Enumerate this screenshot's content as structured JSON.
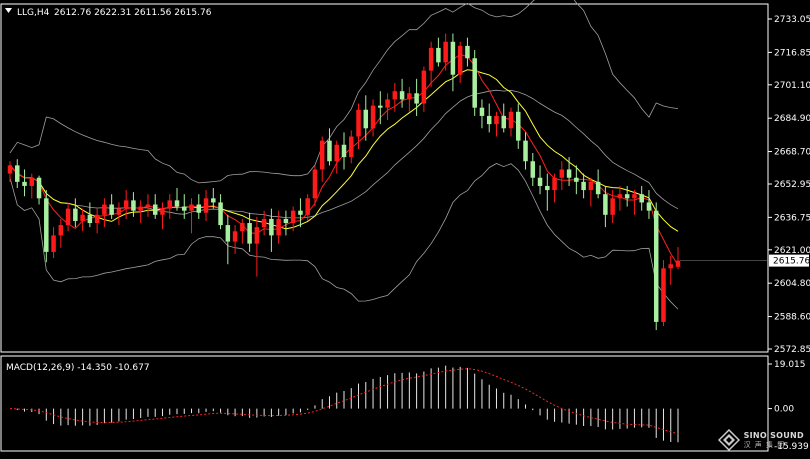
{
  "main_chart": {
    "symbol": "LLG,H4",
    "ohlc_readout": "2612.76 2622.31 2611.56 2615.76",
    "price_ticks": [
      "2733.05",
      "2716.85",
      "2701.10",
      "2684.90",
      "2668.70",
      "2652.95",
      "2636.75",
      "2621.00",
      "2604.80",
      "2588.60",
      "2572.85"
    ],
    "current_price": "2615.76"
  },
  "macd": {
    "label": "MACD(12,26,9) -14.350 -10.677",
    "ticks": [
      "19.015",
      "0.00",
      "-15.939"
    ]
  },
  "watermark": {
    "brand": "SINO SOUND",
    "cn": "汉 声 集 团"
  },
  "colors": {
    "bull": "#ff1a1a",
    "bear": "#a8f0a0",
    "grid": "#ffffff",
    "ma_fast": "#ff2020",
    "ma_slow": "#ffff30",
    "bands": "#a0a0a0",
    "signal": "#ff2020"
  },
  "chart_data": [
    {
      "type": "candlestick",
      "title": "LLG,H4",
      "ylim": [
        2572.85,
        2736
      ],
      "y_ticks": [
        2733.05,
        2716.85,
        2701.1,
        2684.9,
        2668.7,
        2652.95,
        2636.75,
        2621.0,
        2604.8,
        2588.6,
        2572.85
      ],
      "last_price": 2615.76,
      "candles": [
        [
          2658,
          2664,
          2654,
          2662
        ],
        [
          2662,
          2665,
          2651,
          2654
        ],
        [
          2654,
          2660,
          2647,
          2652
        ],
        [
          2652,
          2658,
          2646,
          2656
        ],
        [
          2656,
          2657,
          2643,
          2646
        ],
        [
          2646,
          2650,
          2615,
          2620
        ],
        [
          2620,
          2632,
          2617,
          2628
        ],
        [
          2628,
          2636,
          2622,
          2633
        ],
        [
          2633,
          2644,
          2630,
          2641
        ],
        [
          2641,
          2646,
          2632,
          2635
        ],
        [
          2635,
          2641,
          2630,
          2638
        ],
        [
          2638,
          2644,
          2632,
          2634
        ],
        [
          2634,
          2641,
          2629,
          2638
        ],
        [
          2638,
          2646,
          2632,
          2643
        ],
        [
          2643,
          2648,
          2636,
          2638
        ],
        [
          2638,
          2644,
          2633,
          2641
        ],
        [
          2641,
          2650,
          2636,
          2645
        ],
        [
          2645,
          2649,
          2637,
          2640
        ],
        [
          2640,
          2645,
          2634,
          2642
        ],
        [
          2642,
          2648,
          2637,
          2643
        ],
        [
          2643,
          2648,
          2636,
          2638
        ],
        [
          2638,
          2644,
          2631,
          2641
        ],
        [
          2641,
          2648,
          2636,
          2645
        ],
        [
          2645,
          2651,
          2640,
          2642
        ],
        [
          2642,
          2648,
          2636,
          2640
        ],
        [
          2640,
          2646,
          2629,
          2643
        ],
        [
          2643,
          2648,
          2636,
          2639
        ],
        [
          2639,
          2650,
          2635,
          2646
        ],
        [
          2646,
          2651,
          2641,
          2644
        ],
        [
          2644,
          2648,
          2631,
          2633
        ],
        [
          2633,
          2638,
          2614,
          2625
        ],
        [
          2625,
          2633,
          2619,
          2630
        ],
        [
          2630,
          2636,
          2624,
          2634
        ],
        [
          2634,
          2639,
          2620,
          2624
        ],
        [
          2624,
          2637,
          2608,
          2632
        ],
        [
          2632,
          2640,
          2628,
          2636
        ],
        [
          2636,
          2641,
          2620,
          2628
        ],
        [
          2628,
          2640,
          2624,
          2636
        ],
        [
          2636,
          2640,
          2628,
          2634
        ],
        [
          2634,
          2642,
          2630,
          2640
        ],
        [
          2640,
          2646,
          2632,
          2638
        ],
        [
          2638,
          2648,
          2635,
          2646
        ],
        [
          2646,
          2662,
          2642,
          2660
        ],
        [
          2660,
          2676,
          2654,
          2674
        ],
        [
          2674,
          2680,
          2662,
          2664
        ],
        [
          2664,
          2674,
          2658,
          2672
        ],
        [
          2672,
          2678,
          2660,
          2666
        ],
        [
          2666,
          2679,
          2663,
          2676
        ],
        [
          2676,
          2692,
          2670,
          2689
        ],
        [
          2689,
          2696,
          2674,
          2680
        ],
        [
          2680,
          2694,
          2676,
          2691
        ],
        [
          2691,
          2698,
          2682,
          2690
        ],
        [
          2690,
          2697,
          2684,
          2694
        ],
        [
          2694,
          2702,
          2688,
          2698
        ],
        [
          2698,
          2704,
          2690,
          2694
        ],
        [
          2694,
          2700,
          2688,
          2697
        ],
        [
          2697,
          2704,
          2686,
          2692
        ],
        [
          2692,
          2710,
          2688,
          2708
        ],
        [
          2708,
          2722,
          2700,
          2719
        ],
        [
          2719,
          2724,
          2710,
          2712
        ],
        [
          2712,
          2726,
          2708,
          2722
        ],
        [
          2722,
          2726,
          2698,
          2706
        ],
        [
          2706,
          2722,
          2702,
          2720
        ],
        [
          2720,
          2724,
          2710,
          2714
        ],
        [
          2714,
          2718,
          2686,
          2690
        ],
        [
          2690,
          2694,
          2680,
          2686
        ],
        [
          2686,
          2692,
          2678,
          2682
        ],
        [
          2682,
          2688,
          2676,
          2686
        ],
        [
          2686,
          2692,
          2678,
          2680
        ],
        [
          2680,
          2690,
          2676,
          2688
        ],
        [
          2688,
          2692,
          2670,
          2674
        ],
        [
          2674,
          2678,
          2660,
          2664
        ],
        [
          2664,
          2668,
          2652,
          2656
        ],
        [
          2656,
          2662,
          2648,
          2652
        ],
        [
          2652,
          2658,
          2640,
          2650
        ],
        [
          2650,
          2658,
          2644,
          2656
        ],
        [
          2656,
          2664,
          2650,
          2660
        ],
        [
          2660,
          2666,
          2652,
          2656
        ],
        [
          2656,
          2662,
          2648,
          2654
        ],
        [
          2654,
          2658,
          2646,
          2650
        ],
        [
          2650,
          2656,
          2642,
          2654
        ],
        [
          2654,
          2660,
          2646,
          2648
        ],
        [
          2648,
          2652,
          2632,
          2638
        ],
        [
          2638,
          2650,
          2634,
          2646
        ],
        [
          2646,
          2652,
          2640,
          2648
        ],
        [
          2648,
          2652,
          2642,
          2646
        ],
        [
          2646,
          2650,
          2638,
          2648
        ],
        [
          2648,
          2652,
          2640,
          2644
        ],
        [
          2644,
          2650,
          2636,
          2640
        ],
        [
          2640,
          2644,
          2582,
          2586
        ],
        [
          2586,
          2616,
          2584,
          2612
        ],
        [
          2612,
          2618,
          2604,
          2614
        ],
        [
          2612.76,
          2622.31,
          2611.56,
          2615.76
        ]
      ],
      "series": [
        {
          "name": "",
          "role": "ma_fast",
          "color": "#ff2020"
        },
        {
          "name": "",
          "role": "ma_slow",
          "color": "#ffff30"
        },
        {
          "name": "",
          "role": "bollinger",
          "color": "#a0a0a0"
        }
      ]
    },
    {
      "type": "bar",
      "title": "MACD(12,26,9) -14.350 -10.677",
      "ylim": [
        -17,
        21
      ],
      "y_ticks": [
        19.015,
        0.0,
        -15.939
      ],
      "last_values": {
        "macd": -14.35,
        "signal": -10.677
      }
    }
  ]
}
